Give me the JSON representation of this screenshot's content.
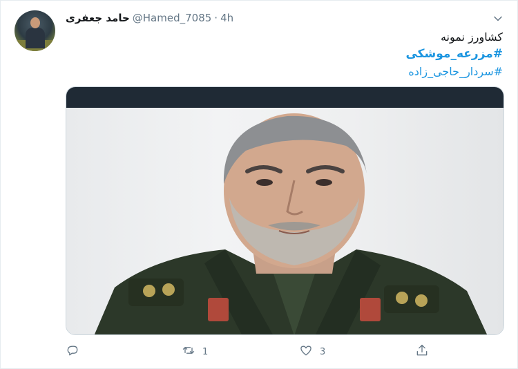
{
  "tweet": {
    "author_name": "حامد جعفری",
    "handle": "@Hamed_7085",
    "separator": "·",
    "time": "4h",
    "lines": [
      "کشاورز نمونه",
      "#مزرعه_موشکی",
      "#سردار_حاجی_زاده"
    ]
  },
  "actions": {
    "reply_count": "",
    "retweet_count": "1",
    "like_count": "3",
    "share_count": ""
  },
  "icons": {
    "avatar": "user-avatar",
    "caret": "chevron-down-icon",
    "reply": "reply-icon",
    "retweet": "retweet-icon",
    "like": "heart-icon",
    "share": "share-icon"
  },
  "colors": {
    "hashtag": "#1b95e0",
    "secondary_text": "#657786",
    "primary_text": "#14171a"
  }
}
